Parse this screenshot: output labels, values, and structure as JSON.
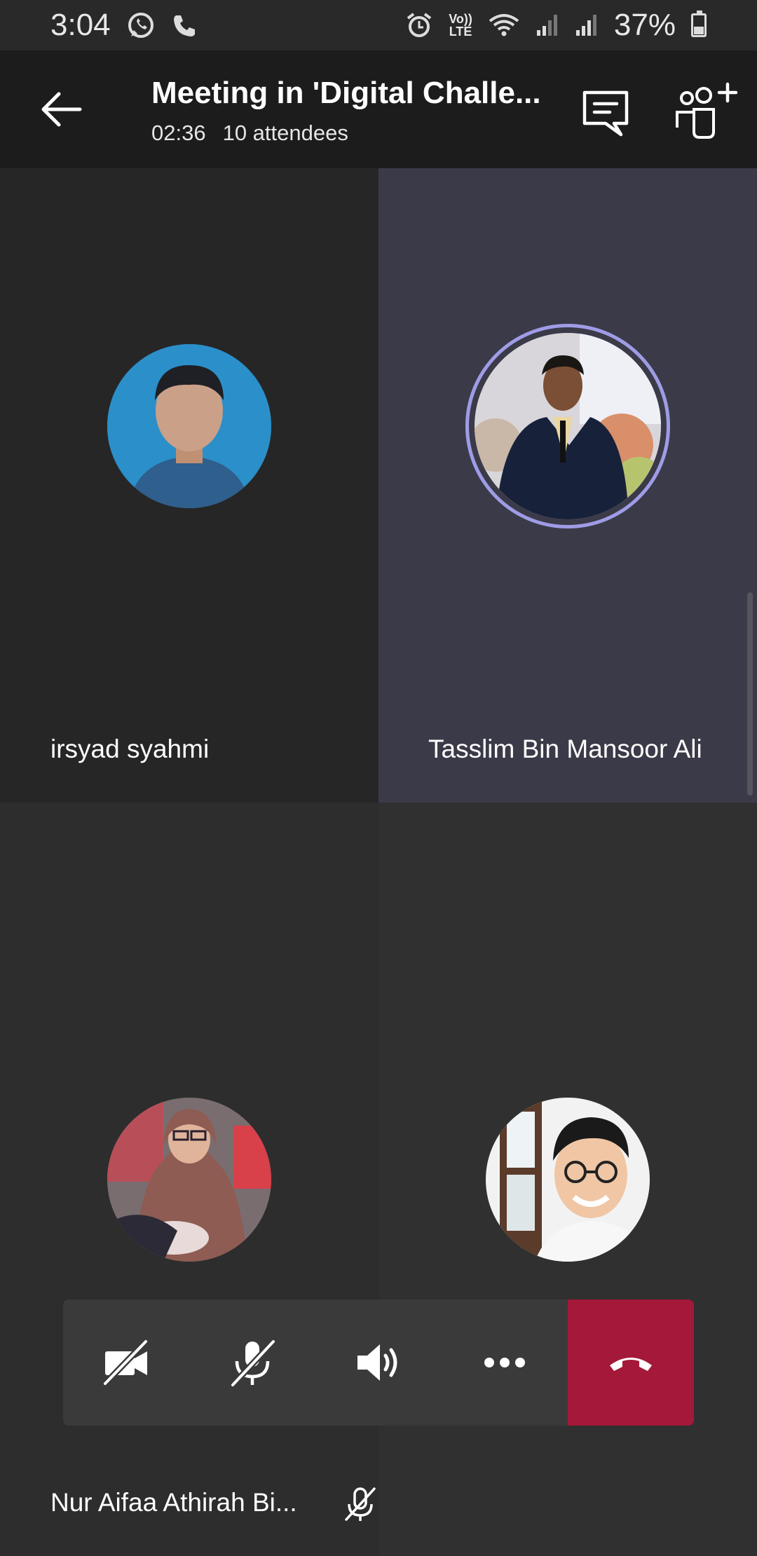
{
  "status_bar": {
    "time": "3:04",
    "volte_top": "Vo))",
    "volte_bottom": "LTE",
    "battery": "37%"
  },
  "header": {
    "title": "Meeting in 'Digital Challe...",
    "duration": "02:36",
    "attendees": "10 attendees"
  },
  "participants": [
    {
      "name": "irsyad syahmi"
    },
    {
      "name": "Tasslim Bin Mansoor Ali"
    },
    {
      "name": "Nur Aifaa Athirah Bi..."
    },
    {
      "name": ""
    }
  ],
  "controls": [
    "video-off",
    "mic-off",
    "speaker",
    "more",
    "hang-up"
  ],
  "colors": {
    "hangup": "#a4183a",
    "speaking_ring": "#9f9ce6",
    "header_bg": "#1c1c1c"
  }
}
